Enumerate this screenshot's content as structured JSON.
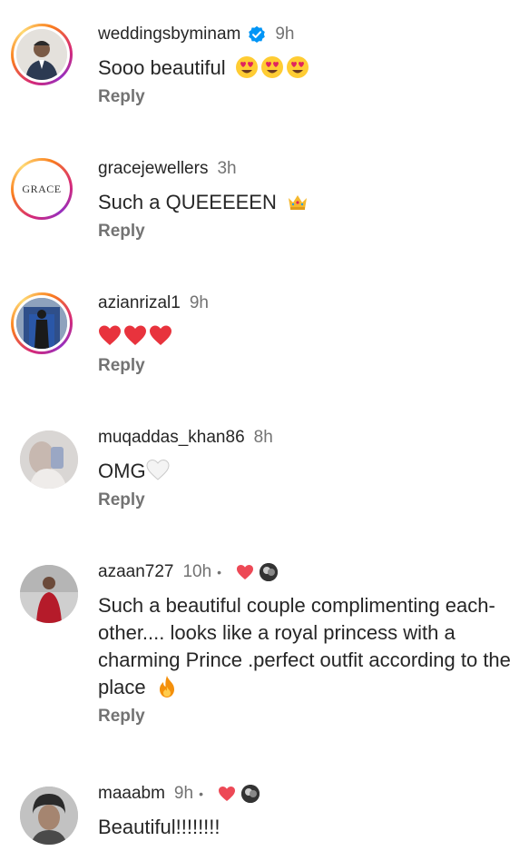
{
  "comments": [
    {
      "username": "weddingsbyminam",
      "verified": true,
      "time": "9h",
      "text": "Sooo beautiful",
      "emojis": [
        "heart-eyes-emoji",
        "heart-eyes-emoji",
        "heart-eyes-emoji"
      ],
      "reply_label": "Reply"
    },
    {
      "username": "gracejewellers",
      "time": "3h",
      "text": "Such a QUEEEEEN",
      "emojis": [
        "crown-emoji"
      ],
      "avatar_logo_text": "GRACE",
      "reply_label": "Reply"
    },
    {
      "username": "azianrizal1",
      "time": "9h",
      "text": "",
      "emojis": [
        "red-heart-emoji",
        "red-heart-emoji",
        "red-heart-emoji"
      ],
      "reply_label": "Reply"
    },
    {
      "username": "muqaddas_khan86",
      "time": "8h",
      "text": "OMG",
      "emojis": [
        "white-heart-emoji"
      ],
      "reply_label": "Reply"
    },
    {
      "username": "azaan727",
      "time": "10h",
      "separator": "•",
      "liked_by_author": true,
      "text": "Such a beautiful couple complimenting each-other.... looks like a royal princess with a charming Prince .perfect outfit according to the place",
      "emojis": [
        "fire-emoji"
      ],
      "reply_label": "Reply"
    },
    {
      "username": "maaabm",
      "time": "9h",
      "separator": "•",
      "liked_by_author": true,
      "text": "Beautiful!!!!!!!!"
    }
  ],
  "colors": {
    "text": "#262626",
    "secondary": "#737373",
    "verified_blue": "#0095f6",
    "heart_red": "#ed4956"
  }
}
